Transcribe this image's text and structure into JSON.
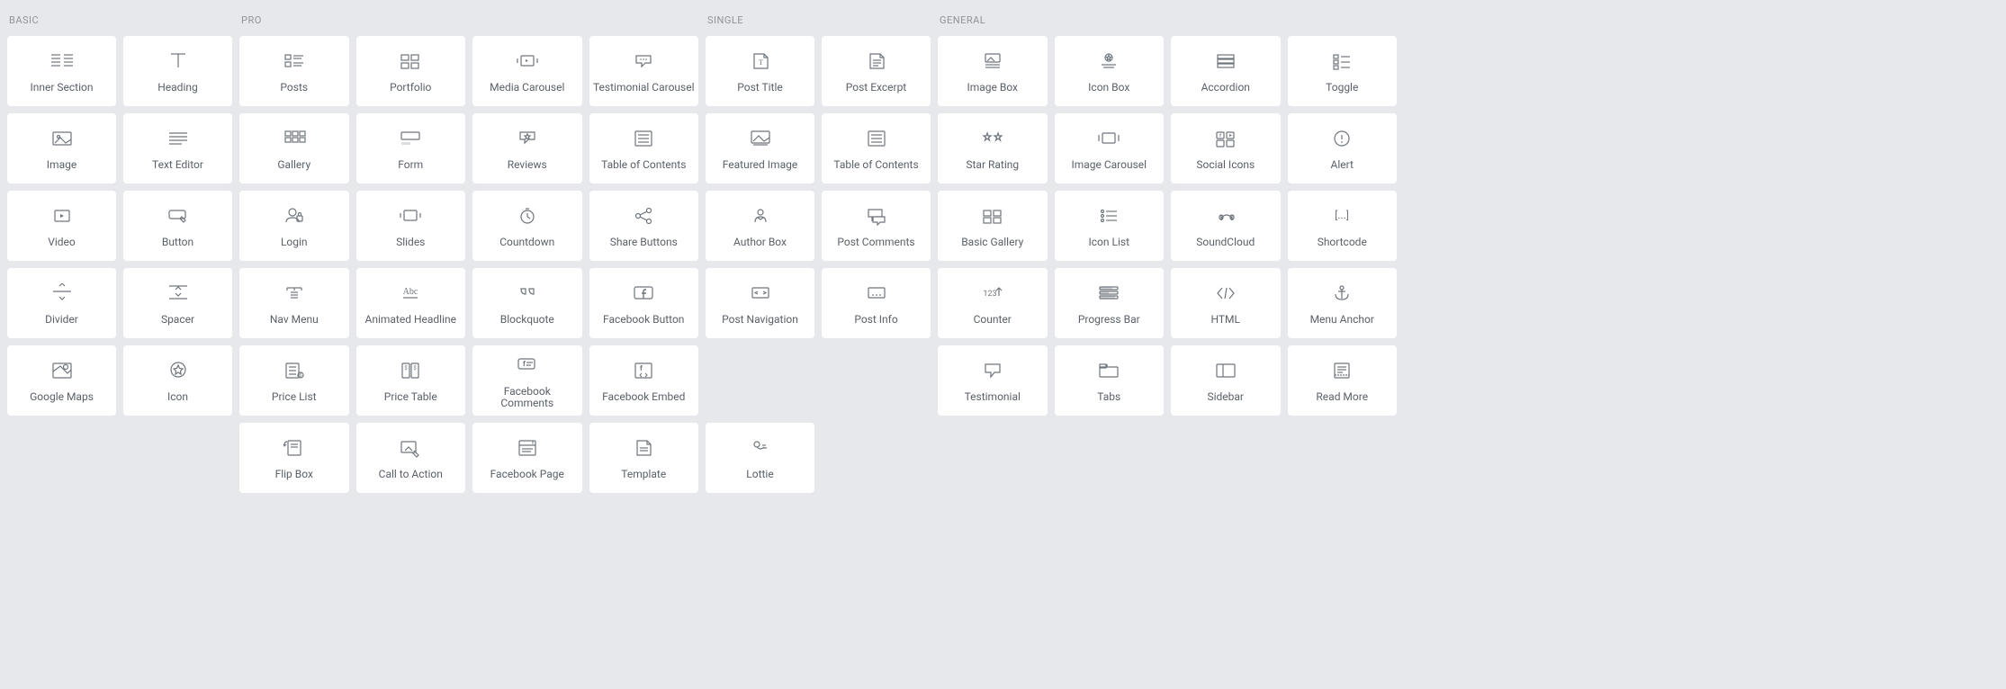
{
  "sections": {
    "basic": {
      "title": "BASIC",
      "items": [
        {
          "label": "Inner Section",
          "icon": "inner-section"
        },
        {
          "label": "Heading",
          "icon": "heading"
        },
        {
          "label": "Image",
          "icon": "image"
        },
        {
          "label": "Text Editor",
          "icon": "text-editor"
        },
        {
          "label": "Video",
          "icon": "video"
        },
        {
          "label": "Button",
          "icon": "button"
        },
        {
          "label": "Divider",
          "icon": "divider"
        },
        {
          "label": "Spacer",
          "icon": "spacer"
        },
        {
          "label": "Google Maps",
          "icon": "google-maps"
        },
        {
          "label": "Icon",
          "icon": "icon"
        }
      ]
    },
    "pro": {
      "title": "PRO",
      "items": [
        {
          "label": "Posts",
          "icon": "posts"
        },
        {
          "label": "Portfolio",
          "icon": "portfolio"
        },
        {
          "label": "Media Carousel",
          "icon": "media-carousel"
        },
        {
          "label": "Testimonial Carousel",
          "icon": "testimonial-carousel"
        },
        {
          "label": "Gallery",
          "icon": "gallery"
        },
        {
          "label": "Form",
          "icon": "form"
        },
        {
          "label": "Reviews",
          "icon": "reviews"
        },
        {
          "label": "Table of Contents",
          "icon": "toc"
        },
        {
          "label": "Login",
          "icon": "login"
        },
        {
          "label": "Slides",
          "icon": "slides"
        },
        {
          "label": "Countdown",
          "icon": "countdown"
        },
        {
          "label": "Share Buttons",
          "icon": "share"
        },
        {
          "label": "Nav Menu",
          "icon": "nav-menu"
        },
        {
          "label": "Animated Headline",
          "icon": "animated-headline"
        },
        {
          "label": "Blockquote",
          "icon": "blockquote"
        },
        {
          "label": "Facebook Button",
          "icon": "fb-button"
        },
        {
          "label": "Price List",
          "icon": "price-list"
        },
        {
          "label": "Price Table",
          "icon": "price-table"
        },
        {
          "label": "Facebook Comments",
          "icon": "fb-comments"
        },
        {
          "label": "Facebook Embed",
          "icon": "fb-embed"
        },
        {
          "label": "Flip Box",
          "icon": "flip-box"
        },
        {
          "label": "Call to Action",
          "icon": "cta"
        },
        {
          "label": "Facebook Page",
          "icon": "fb-page"
        },
        {
          "label": "Template",
          "icon": "template"
        }
      ]
    },
    "single": {
      "title": "SINGLE",
      "items": [
        {
          "label": "Post Title",
          "icon": "post-title"
        },
        {
          "label": "Post Excerpt",
          "icon": "post-excerpt"
        },
        {
          "label": "Featured Image",
          "icon": "featured-image"
        },
        {
          "label": "Table of Contents",
          "icon": "toc"
        },
        {
          "label": "Author Box",
          "icon": "author-box"
        },
        {
          "label": "Post Comments",
          "icon": "post-comments"
        },
        {
          "label": "Post Navigation",
          "icon": "post-nav"
        },
        {
          "label": "Post Info",
          "icon": "post-info"
        },
        {
          "label": "Lottie",
          "icon": "lottie"
        }
      ]
    },
    "general": {
      "title": "GENERAL",
      "items": [
        {
          "label": "Image Box",
          "icon": "image-box"
        },
        {
          "label": "Icon Box",
          "icon": "icon-box"
        },
        {
          "label": "Accordion",
          "icon": "accordion"
        },
        {
          "label": "Toggle",
          "icon": "toggle"
        },
        {
          "label": "Star Rating",
          "icon": "star-rating"
        },
        {
          "label": "Image Carousel",
          "icon": "image-carousel"
        },
        {
          "label": "Social Icons",
          "icon": "social-icons"
        },
        {
          "label": "Alert",
          "icon": "alert"
        },
        {
          "label": "Basic Gallery",
          "icon": "basic-gallery"
        },
        {
          "label": "Icon List",
          "icon": "icon-list"
        },
        {
          "label": "SoundCloud",
          "icon": "soundcloud"
        },
        {
          "label": "Shortcode",
          "icon": "shortcode"
        },
        {
          "label": "Counter",
          "icon": "counter"
        },
        {
          "label": "Progress Bar",
          "icon": "progress-bar"
        },
        {
          "label": "HTML",
          "icon": "html"
        },
        {
          "label": "Menu Anchor",
          "icon": "menu-anchor"
        },
        {
          "label": "Testimonial",
          "icon": "testimonial"
        },
        {
          "label": "Tabs",
          "icon": "tabs"
        },
        {
          "label": "Sidebar",
          "icon": "sidebar"
        },
        {
          "label": "Read More",
          "icon": "read-more"
        }
      ]
    }
  }
}
